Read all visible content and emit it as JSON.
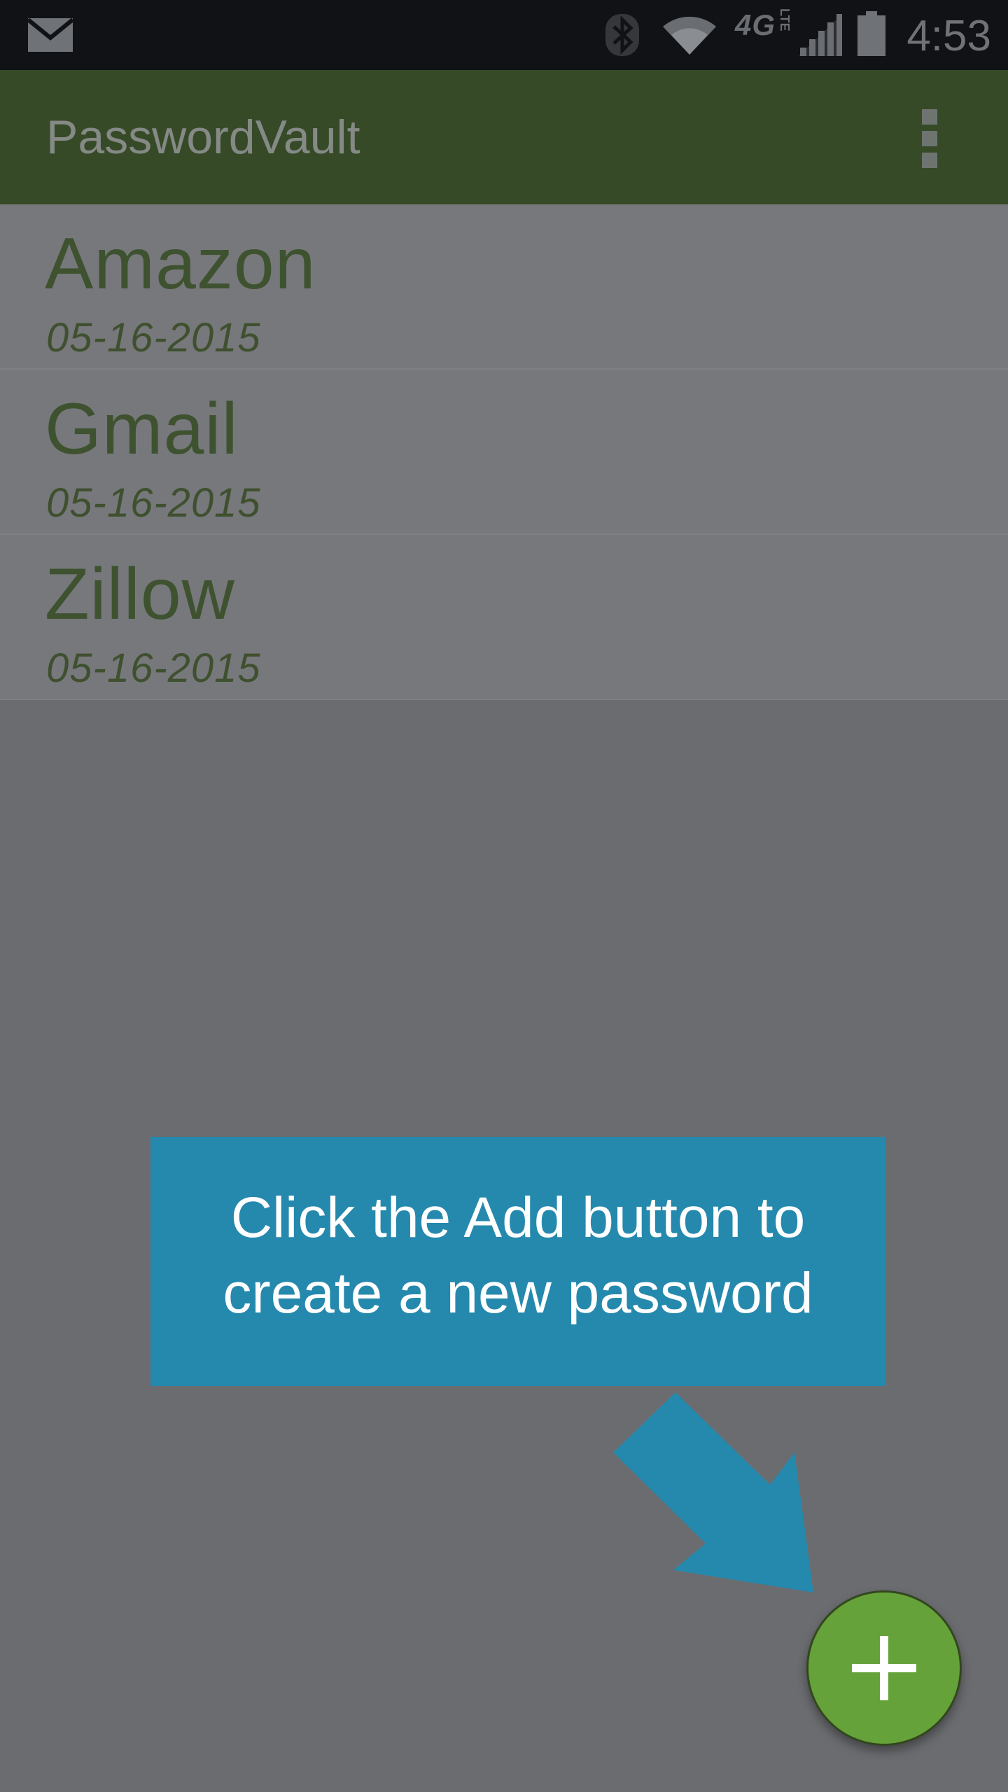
{
  "status_bar": {
    "icons": [
      "mail-icon",
      "bluetooth-icon",
      "wifi-icon",
      "cell-signal-icon",
      "battery-icon"
    ],
    "network": "4G",
    "network_sub": "LTE",
    "time": "4:53"
  },
  "app_bar": {
    "title": "PasswordVault",
    "menu_icon": "overflow-menu-icon"
  },
  "list": {
    "items": [
      {
        "title": "Amazon",
        "date": "05-16-2015"
      },
      {
        "title": "Gmail",
        "date": "05-16-2015"
      },
      {
        "title": "Zillow",
        "date": "05-16-2015"
      }
    ]
  },
  "tooltip": {
    "text": "Click the Add button to create a new password",
    "line1": "Click the Add button to",
    "line2": "create a new password",
    "color": "#2589ad"
  },
  "fab": {
    "icon": "plus-icon",
    "color": "#66a23a"
  },
  "colors": {
    "app_bar": "#374a28",
    "overlay": "#6b6c70",
    "status_bar": "#111216"
  }
}
